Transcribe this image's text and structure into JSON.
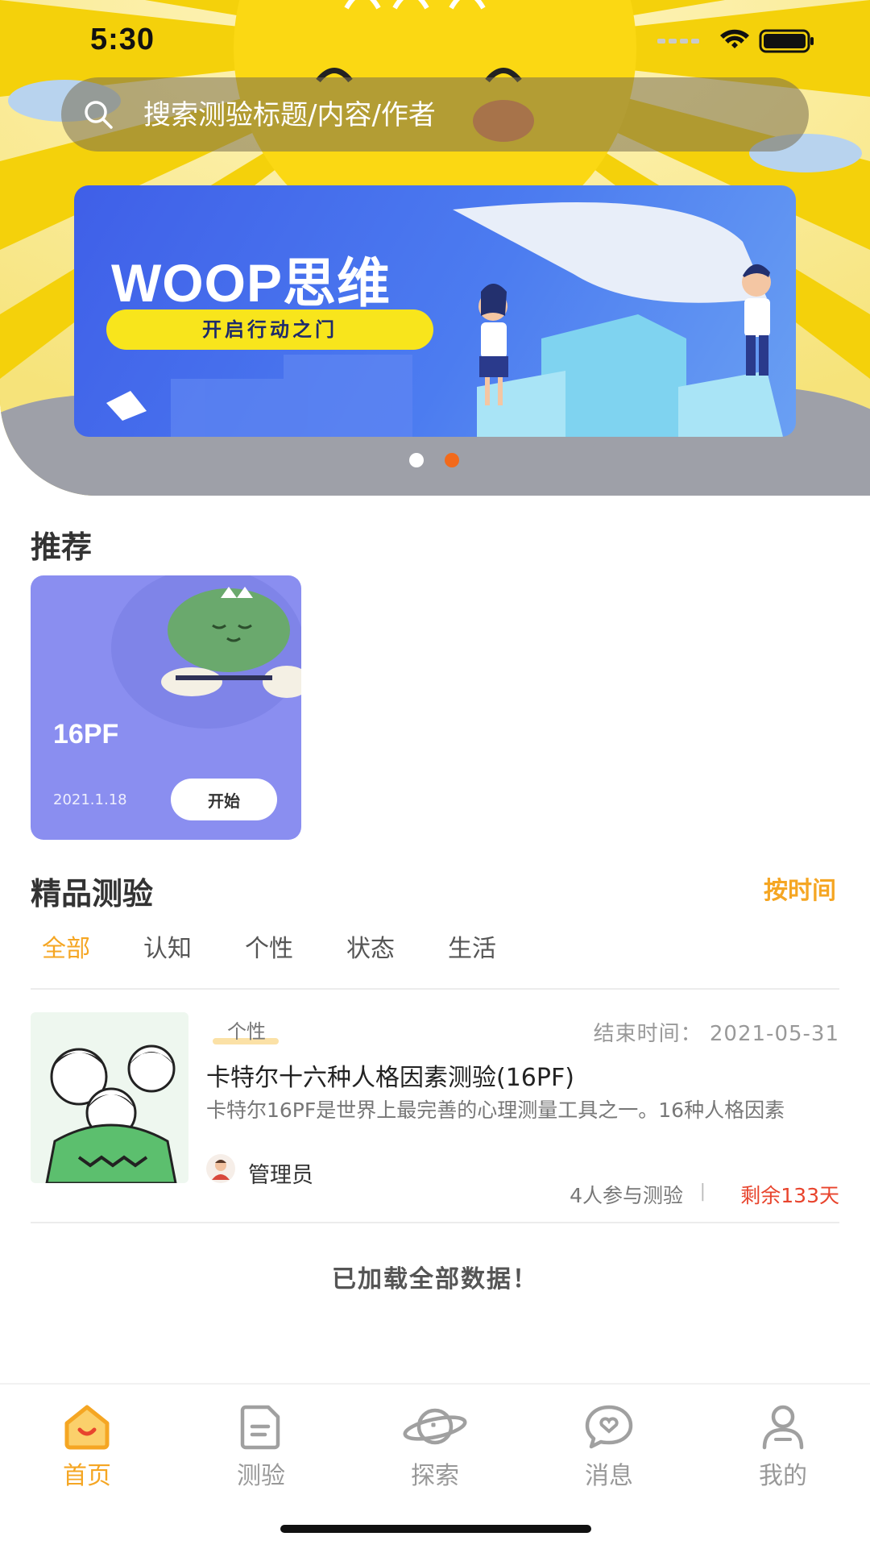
{
  "status_bar": {
    "time": "5:30"
  },
  "search": {
    "placeholder": "搜索测验标题/内容/作者"
  },
  "banner": {
    "title": "WOOP思维",
    "subtitle": "开启行动之门",
    "active_dot": 1,
    "dot_count": 2
  },
  "recommend": {
    "title": "推荐",
    "card": {
      "title": "16PF",
      "date": "2021.1.18",
      "start_label": "开始"
    }
  },
  "quality": {
    "title": "精品测验",
    "sort_label": "按时间",
    "tabs": [
      {
        "label": "全部",
        "active": true
      },
      {
        "label": "认知",
        "active": false
      },
      {
        "label": "个性",
        "active": false
      },
      {
        "label": "状态",
        "active": false
      },
      {
        "label": "生活",
        "active": false
      }
    ],
    "items": [
      {
        "tag": "个性",
        "end_time": "结束时间：  2021-05-31",
        "title": "卡特尔十六种人格因素测验(16PF)",
        "description": "卡特尔16PF是世界上最完善的心理测量工具之一。16种人格因素",
        "author": "管理员",
        "participants": "4人参与测验",
        "separator": "|",
        "remaining": "剩余133天"
      }
    ],
    "load_all": "已加载全部数据！"
  },
  "bottom_nav": [
    {
      "label": "首页",
      "icon": "home-icon",
      "active": true
    },
    {
      "label": "测验",
      "icon": "document-icon",
      "active": false
    },
    {
      "label": "探索",
      "icon": "planet-icon",
      "active": false
    },
    {
      "label": "消息",
      "icon": "chat-heart-icon",
      "active": false
    },
    {
      "label": "我的",
      "icon": "user-icon",
      "active": false
    }
  ],
  "colors": {
    "accent": "#f5a623",
    "remaining_red": "#e8442d",
    "banner_blue": "#3f5fe8",
    "card_purple": "#8a8ef0",
    "sun_yellow": "#f3d20a"
  }
}
